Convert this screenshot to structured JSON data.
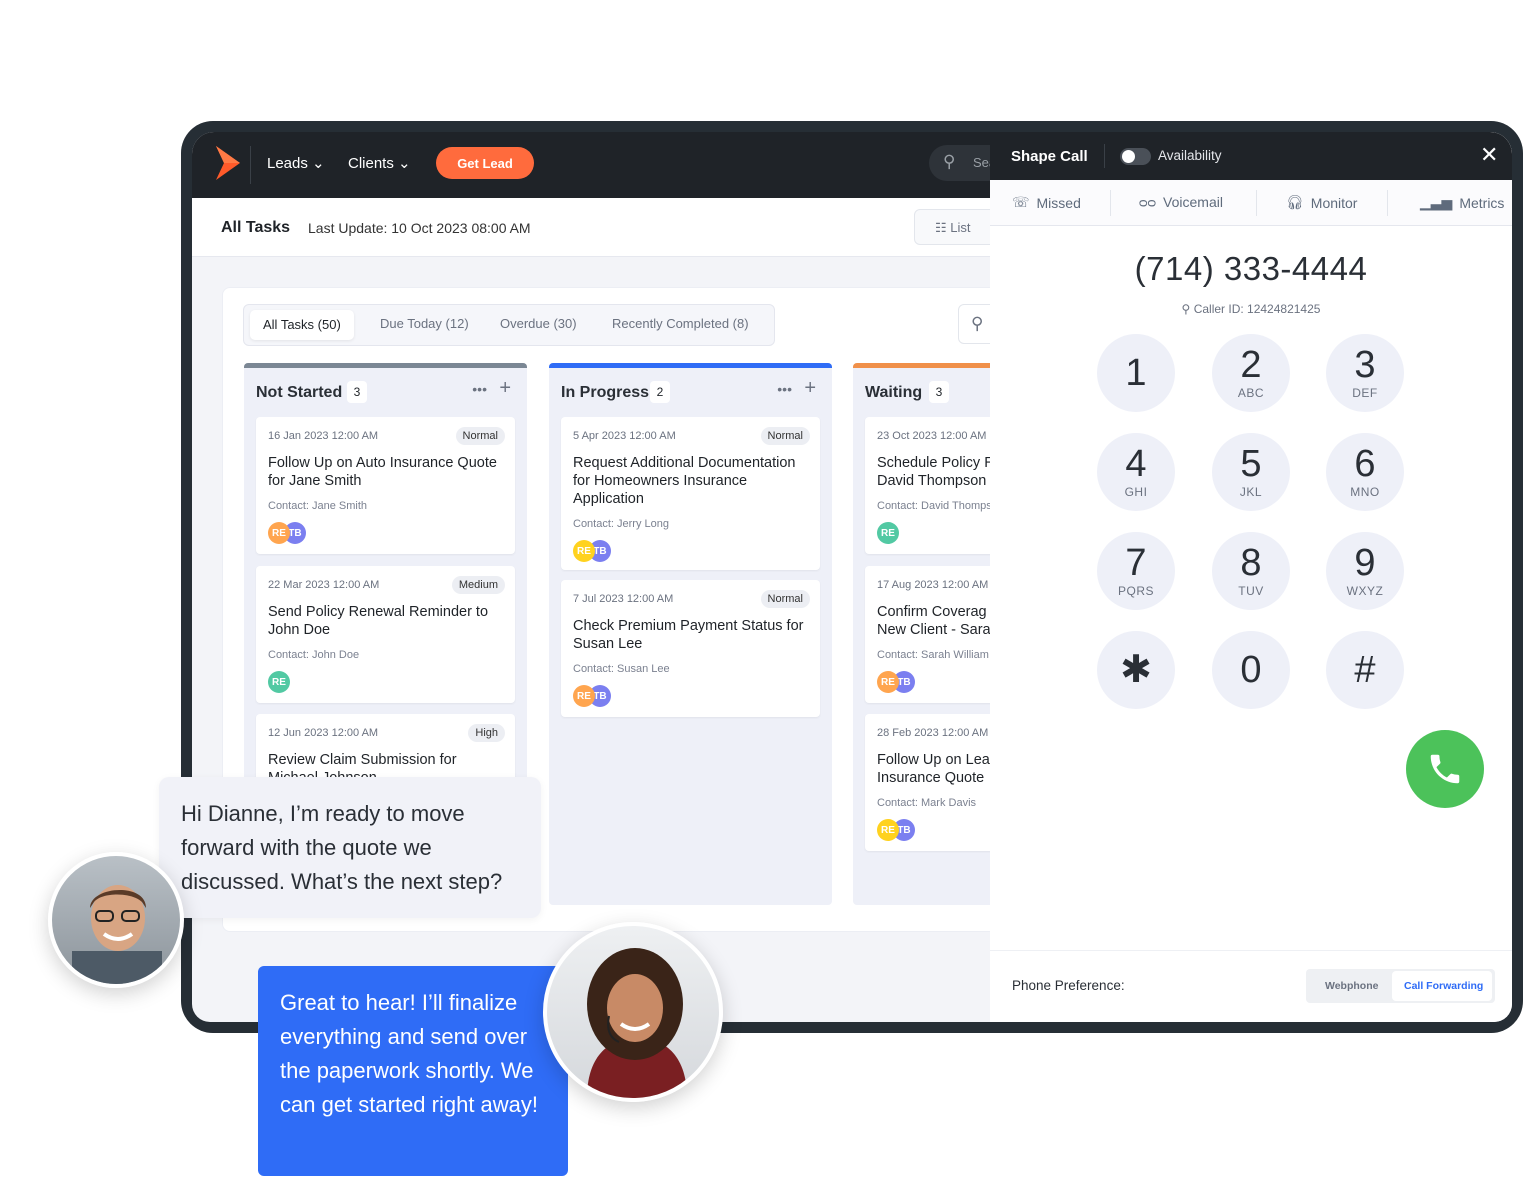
{
  "nav": {
    "leads": "Leads",
    "clients": "Clients",
    "get_lead": "Get Lead",
    "search_placeholder": "Sea"
  },
  "subheader": {
    "title": "All Tasks",
    "last_update": "Last Update: 10 Oct 2023 08:00 AM",
    "view_toggle": "List"
  },
  "filters": [
    {
      "label": "All Tasks (50)",
      "active": true
    },
    {
      "label": "Due Today (12)"
    },
    {
      "label": "Overdue (30)"
    },
    {
      "label": "Recently Completed (8)"
    }
  ],
  "columns": [
    {
      "title": "Not Started",
      "count": "3",
      "color": "#7b8794",
      "cards": [
        {
          "date": "16 Jan 2023 12:00 AM",
          "priority": "Normal",
          "title": "Follow Up on Auto Insurance Quote for Jane Smith",
          "contact": "Contact: Jane Smith",
          "avatars": [
            "RE",
            "TB"
          ]
        },
        {
          "date": "22 Mar 2023 12:00 AM",
          "priority": "Medium",
          "title": "Send Policy Renewal Reminder to John Doe",
          "contact": "Contact: John Doe",
          "avatars": [
            "RE"
          ]
        },
        {
          "date": "12 Jun 2023 12:00 AM",
          "priority": "High",
          "title": "Review Claim Submission for Michael Johnson"
        }
      ]
    },
    {
      "title": "In Progress",
      "count": "2",
      "color": "#2f6cf6",
      "cards": [
        {
          "date": "5 Apr 2023 12:00 AM",
          "priority": "Normal",
          "title": "Request Additional Documentation for Homeowners Insurance Application",
          "contact": "Contact: Jerry Long",
          "avatars": [
            "RE",
            "TB"
          ]
        },
        {
          "date": "7 Jul 2023 12:00 AM",
          "priority": "Normal",
          "title": "Check Premium Payment Status for Susan Lee",
          "contact": "Contact: Susan Lee",
          "avatars": [
            "RE",
            "TB"
          ]
        }
      ]
    },
    {
      "title": "Waiting",
      "count": "3",
      "color": "#f0904a",
      "cards": [
        {
          "date": "23 Oct 2023 12:00 AM",
          "title": "Schedule Policy R David Thompson",
          "contact": "Contact: David Thomps",
          "avatars": [
            "RE"
          ]
        },
        {
          "date": "17 Aug 2023 12:00 AM",
          "title": "Confirm Coverag New Client - Sara",
          "contact": "Contact: Sarah William",
          "avatars": [
            "RE",
            "TB"
          ]
        },
        {
          "date": "28 Feb 2023 12:00 AM",
          "title": "Follow Up on Lea Insurance Quote",
          "contact": "Contact: Mark Davis",
          "avatars": [
            "RE",
            "TB"
          ]
        }
      ]
    }
  ],
  "dialer": {
    "title": "Shape Call",
    "availability": "Availability",
    "availability_on": false,
    "tabs": [
      {
        "label": "Missed",
        "icon": "missed-call-icon"
      },
      {
        "label": "Voicemail",
        "icon": "voicemail-icon"
      },
      {
        "label": "Monitor",
        "icon": "headset-icon"
      },
      {
        "label": "Metrics",
        "icon": "bar-chart-icon"
      }
    ],
    "number": "(714) 333-4444",
    "caller_id": "Caller ID: 12424821425",
    "keys": [
      {
        "d": "1",
        "l": ""
      },
      {
        "d": "2",
        "l": "ABC"
      },
      {
        "d": "3",
        "l": "DEF"
      },
      {
        "d": "4",
        "l": "GHI"
      },
      {
        "d": "5",
        "l": "JKL"
      },
      {
        "d": "6",
        "l": "MNO"
      },
      {
        "d": "7",
        "l": "PQRS"
      },
      {
        "d": "8",
        "l": "TUV"
      },
      {
        "d": "9",
        "l": "WXYZ"
      },
      {
        "d": "✱",
        "l": ""
      },
      {
        "d": "0",
        "l": ""
      },
      {
        "d": "#",
        "l": ""
      }
    ],
    "phone_pref_label": "Phone Preference:",
    "pref_options": [
      "Webphone",
      "Call Forwarding"
    ],
    "pref_selected": "Call Forwarding",
    "call_color": "#4cc25a"
  },
  "chat": {
    "client_message": "Hi Dianne, I’m ready to move forward with the quote we discussed. What’s the next step?",
    "agent_message": "Great to hear! I’ll finalize everything and send over the paperwork shortly. We can get started right away!"
  },
  "colors": {
    "accent": "#ff6b3d",
    "blue": "#2f6cf6",
    "nav": "#1f2328"
  }
}
